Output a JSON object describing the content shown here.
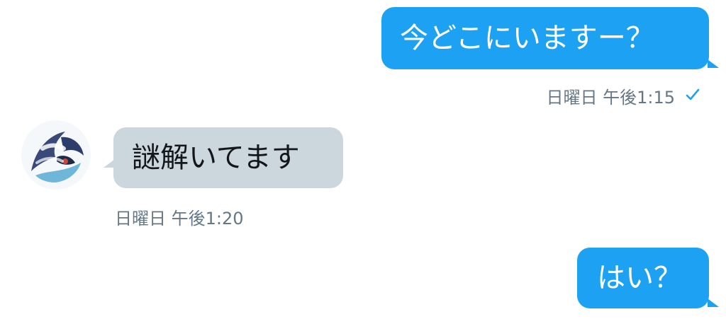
{
  "conversation": {
    "messages": [
      {
        "direction": "outgoing",
        "text": "今どこにいますー？",
        "timestamp": "日曜日 午後1:15",
        "status": "read-check-icon"
      },
      {
        "direction": "incoming",
        "text": "謎解いてます",
        "timestamp": "日曜日 午後1:20"
      },
      {
        "direction": "outgoing",
        "text": "はい？"
      }
    ]
  },
  "colors": {
    "outgoing_bubble": "#1da1f2",
    "incoming_bubble": "#ccd6dd",
    "timestamp_text": "#657786",
    "check": "#1da1f2"
  }
}
